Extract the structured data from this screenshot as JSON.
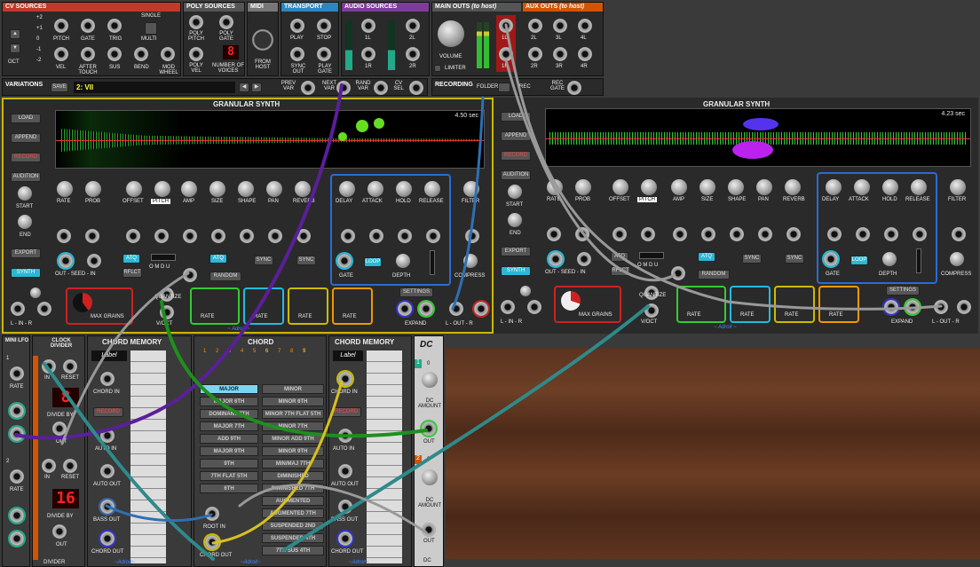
{
  "top": {
    "cv_sources": {
      "title": "CV SOURCES",
      "oct_values": [
        "+2",
        "+1",
        "0",
        "-1",
        "-2"
      ],
      "oct_label": "OCT",
      "single": "SINGLE",
      "multi": "MULTI",
      "jacks_row1": [
        "PITCH",
        "GATE",
        "TRIG"
      ],
      "jacks_row2": [
        "VEL",
        "AFTER TOUCH",
        "SUS",
        "BEND",
        "MOD WHEEL"
      ]
    },
    "poly_sources": {
      "title": "POLY SOURCES",
      "labels": [
        "POLY PITCH",
        "POLY GATE",
        "POLY VEL",
        "NUMBER OF VOICES"
      ],
      "voices": "8"
    },
    "midi": {
      "title": "MIDI",
      "from_host": "FROM HOST"
    },
    "transport": {
      "title": "TRANSPORT",
      "labels": [
        "PLAY",
        "STOP",
        "SYNC OUT",
        "PLAY GATE"
      ]
    },
    "audio_sources": {
      "title": "AUDIO SOURCES",
      "labels": [
        "1L",
        "2L",
        "1R",
        "2R"
      ]
    },
    "main_outs": {
      "title": "MAIN OUTS",
      "sub": "(to host)",
      "volume": "VOLUME",
      "limiter": "LIMITER",
      "labels": [
        "1L",
        "1R"
      ]
    },
    "aux_outs": {
      "title": "AUX OUTS",
      "sub": "(to host)",
      "labels": [
        "2L",
        "3L",
        "4L",
        "2R",
        "3R",
        "4R"
      ]
    },
    "variations": {
      "title": "VARIATIONS",
      "save": "SAVE",
      "name": "2: VII",
      "prev": "PREV VAR",
      "next": "NEXT VAR",
      "rand": "RAND VAR",
      "cv_sel": "CV SEL"
    },
    "recording": {
      "title": "RECORDING",
      "folder": "FOLDER",
      "rec": "REC",
      "rec_gate": "REC GATE"
    }
  },
  "granular": [
    {
      "title": "GRANULAR SYNTH",
      "time": "4.50 sec"
    },
    {
      "title": "GRANULAR SYNTH",
      "time": "4.23 sec"
    }
  ],
  "gran_common": {
    "buttons": [
      "LOAD",
      "APPEND",
      "RECORD",
      "AUDITION"
    ],
    "start": "START",
    "end": "END",
    "export": "EXPORT",
    "synth": "SYNTH",
    "knobs": [
      "RATE",
      "PROB",
      "OFFSET",
      "PITCH",
      "AMP",
      "SIZE",
      "SHAPE",
      "PAN",
      "REVERB"
    ],
    "env": [
      "DELAY",
      "ATTACK",
      "HOLD",
      "RELEASE"
    ],
    "filter": "FILTER",
    "out_seed_in": "OUT - SEED - IN",
    "atq": "ATQ",
    "reflect": "RFLCT",
    "omdu": "O M D U",
    "quantize": "QUANTIZE",
    "vpoct": "V/OCT",
    "random": "RANDOM",
    "sync": "SYNC",
    "loop": "LOOP",
    "gate": "GATE",
    "depth": "DEPTH",
    "compress": "COMPRESS",
    "lin": "L - IN - R",
    "lout": "L - OUT - R",
    "max_grains": "MAX GRAINS",
    "rate": "RATE",
    "settings": "SETTINGS",
    "expand": "EXPAND",
    "brand": "~ Adroit ~"
  },
  "mini_lfo": {
    "title": "MINI LFO",
    "rate": "RATE",
    "n1": "1",
    "n2": "2"
  },
  "clock_divider": {
    "title": "CLOCK DIVIDER",
    "in": "IN",
    "reset": "RESET",
    "div1": "8",
    "div2": "16",
    "divide_by": "DIVIDE BY",
    "out": "OUT",
    "brand": "DIVIDER"
  },
  "chord_memory_1": {
    "title": "CHORD MEMORY",
    "label": "Label",
    "chord_in": "CHORD IN",
    "record": "RECORD",
    "auto_in": "AUTO IN",
    "auto_out": "AUTO OUT",
    "bass_out": "BASS OUT",
    "chord_out": "CHORD OUT",
    "brand": "~Adroit~"
  },
  "chord": {
    "title": "CHORD",
    "numbers": [
      "1",
      "2",
      "3",
      "4",
      "5",
      "6",
      "7",
      "8",
      "9"
    ],
    "left": [
      "MAJOR",
      "MAJOR 6TH",
      "DOMINANT 7TH",
      "MAJOR 7TH",
      "ADD 9TH",
      "MAJOR 9TH",
      "9TH",
      "7TH FLAT 5TH",
      "6TH"
    ],
    "right": [
      "MINOR",
      "MINOR 6TH",
      "MINOR 7TH FLAT 5TH",
      "MINOR 7TH",
      "MINOR ADD 9TH",
      "MINOR 9TH",
      "MIN/MAJ 7TH",
      "DIMINISHED",
      "DIMINISHED 7TH",
      "AUGMENTED",
      "AUGMENTED 7TH",
      "SUSPENDED 2ND",
      "SUSPENDED 4TH",
      "7TH SUS 4TH"
    ],
    "root_in": "ROOT IN",
    "chord_out": "CHORD OUT",
    "brand": "~Adroit~"
  },
  "chord_memory_2": {
    "title": "CHORD MEMORY",
    "label": "Label",
    "chord_in": "CHORD IN",
    "record": "RECORD",
    "auto_in": "AUTO IN",
    "auto_out": "AUTO OUT",
    "bass_out": "BASS OUT",
    "chord_out": "CHORD OUT",
    "brand": "~Adroit~"
  },
  "dc": {
    "title": "DC",
    "n1": "1",
    "n2": "2",
    "zero": "0",
    "amount": "DC AMOUNT",
    "out": "OUT",
    "brand": "DC"
  },
  "colors": {
    "yellow": "#c9b800",
    "blue": "#2a6bd6",
    "cable_purple": "#5a1f9a",
    "cable_green": "#1f8f1f",
    "cable_grey": "#999999",
    "cable_teal": "#2f8a8a",
    "cable_yellow": "#d8c020",
    "cable_blue": "#2f6fb3",
    "accent_red": "#cc1111"
  }
}
